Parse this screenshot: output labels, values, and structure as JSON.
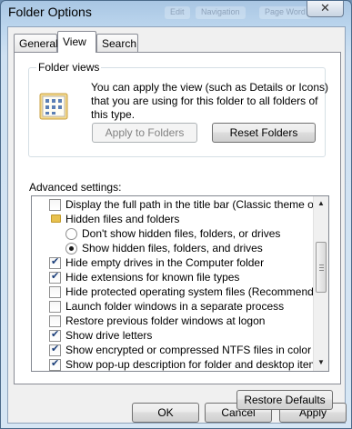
{
  "window": {
    "title": "Folder Options",
    "close_glyph": "✕",
    "background_hints": [
      "Edit",
      "Navigation",
      "Page Word"
    ]
  },
  "tabs": [
    {
      "label": "General"
    },
    {
      "label": "View"
    },
    {
      "label": "Search"
    }
  ],
  "folder_views": {
    "legend": "Folder views",
    "icon": "folder-views-icon",
    "description": "You can apply the view (such as Details or Icons) that you are using for this folder to all folders of this type.",
    "apply_button": "Apply to Folders",
    "reset_button": "Reset Folders"
  },
  "advanced": {
    "label": "Advanced settings:",
    "items": [
      {
        "type": "checkbox",
        "checked": false,
        "label": "Display the full path in the title bar (Classic theme only)"
      },
      {
        "type": "folder",
        "label": "Hidden files and folders"
      },
      {
        "type": "radio",
        "checked": false,
        "label": "Don't show hidden files, folders, or drives"
      },
      {
        "type": "radio",
        "checked": true,
        "label": "Show hidden files, folders, and drives"
      },
      {
        "type": "checkbox",
        "checked": true,
        "label": "Hide empty drives in the Computer folder"
      },
      {
        "type": "checkbox",
        "checked": true,
        "label": "Hide extensions for known file types"
      },
      {
        "type": "checkbox",
        "checked": false,
        "label": "Hide protected operating system files (Recommended)"
      },
      {
        "type": "checkbox",
        "checked": false,
        "label": "Launch folder windows in a separate process"
      },
      {
        "type": "checkbox",
        "checked": false,
        "label": "Restore previous folder windows at logon"
      },
      {
        "type": "checkbox",
        "checked": true,
        "label": "Show drive letters"
      },
      {
        "type": "checkbox",
        "checked": true,
        "label": "Show encrypted or compressed NTFS files in color"
      },
      {
        "type": "checkbox",
        "checked": true,
        "label": "Show pop-up description for folder and desktop items"
      }
    ],
    "restore_button": "Restore Defaults"
  },
  "footer": {
    "ok": "OK",
    "cancel": "Cancel",
    "apply": "Apply"
  },
  "colors": {
    "title_gradient_top": "#a9c6e3",
    "checkmark": "#1b3f7a",
    "dialog_face": "#f0f0f0"
  }
}
